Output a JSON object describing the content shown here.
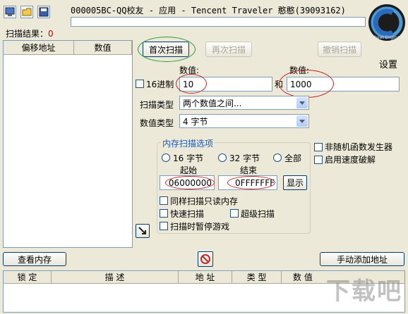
{
  "window": {
    "title": "000005BC-QQ校友 - 应用 - Tencent Traveler  憨憨(39093162)"
  },
  "toolbar": {
    "icons": [
      "process-select-icon",
      "open-folder-icon",
      "save-icon"
    ]
  },
  "scan_results": {
    "label": "扫描结果：",
    "count": "0"
  },
  "results_table": {
    "col_offset": "偏移地址",
    "col_value": "数值"
  },
  "buttons": {
    "first_scan": "首次扫描",
    "next_scan": "再次扫描",
    "undo_scan": "撤销扫描",
    "settings": "设置",
    "view_memory": "查看内存",
    "add_address": "手动添加地址",
    "show": "显示"
  },
  "scan": {
    "hex_label": "16进制",
    "value_label_1": "数值:",
    "value_label_2": "数值:",
    "value_1": "10",
    "and_label": "和",
    "value_2": "1000",
    "scan_type_label": "扫描类型",
    "scan_type_value": "两个数值之间...",
    "value_type_label": "数值类型",
    "value_type_value": "4 字节"
  },
  "memory_options": {
    "title": "内存扫描选项",
    "radio_16": "16 字节",
    "radio_32": "32 字节",
    "radio_all": "全部",
    "start_label": "起始",
    "end_label": "结束",
    "start_value": "06000000",
    "end_value": "0FFFFFFF",
    "opt_readonly": "同样扫描只读内存",
    "opt_fast": "快速扫描",
    "opt_super": "超级扫描",
    "opt_pause": "扫描时暂停游戏"
  },
  "side_options": {
    "random_gen": "非随机函数发生器",
    "speed_hack": "启用速度破解"
  },
  "address_table": {
    "col_lock": "锁 定",
    "col_desc": "描 述",
    "col_addr": "地 址",
    "col_type": "类 型",
    "col_value": "数 值"
  },
  "logo": {
    "text": "Cheat Engine"
  },
  "watermark": {
    "text": "下载吧"
  },
  "colors": {
    "annotation_red": "#c0282a",
    "annotation_green": "#2e9a3a",
    "results_count": "#cc0000"
  }
}
